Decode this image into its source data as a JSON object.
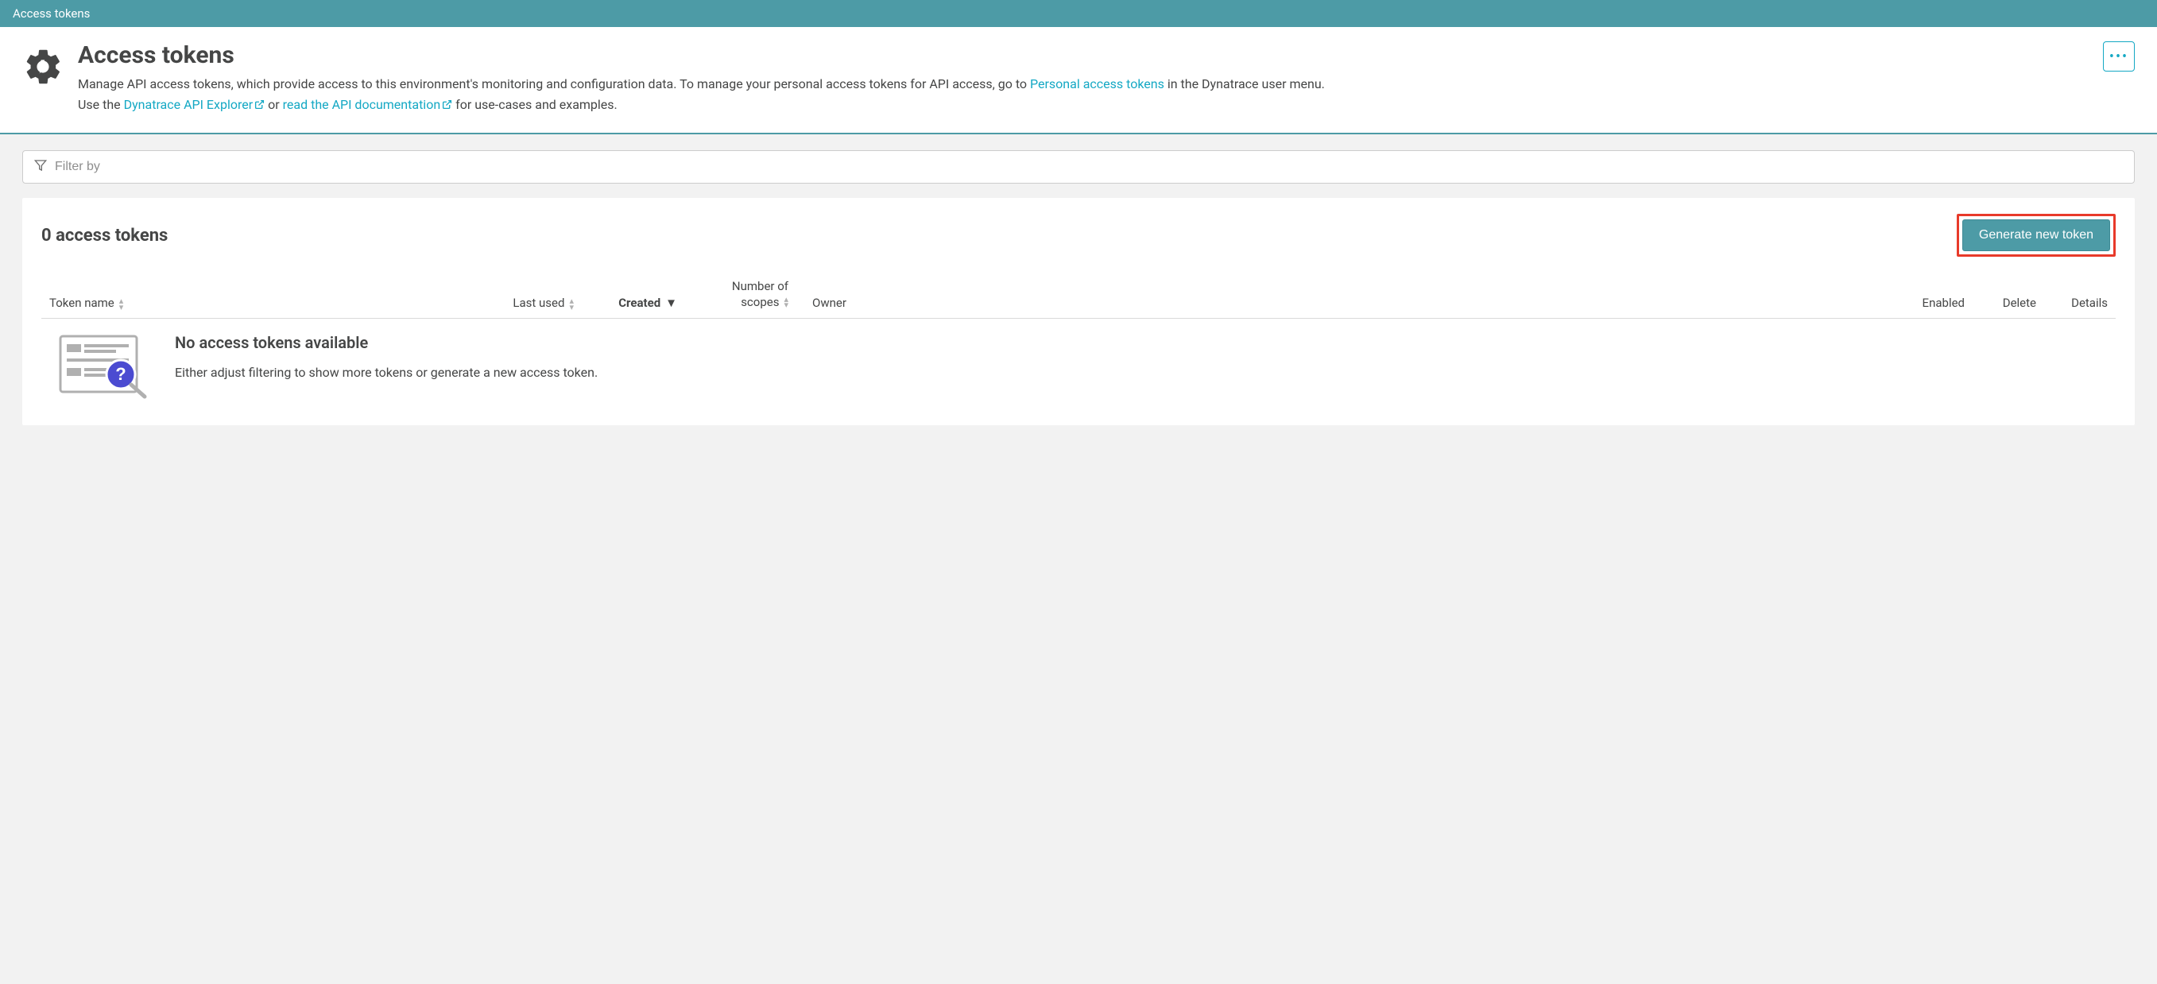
{
  "topBar": {
    "title": "Access tokens"
  },
  "header": {
    "title": "Access tokens",
    "desc1_a": "Manage API access tokens, which provide access to this environment's monitoring and configuration data. To manage your personal access tokens for API access, go to ",
    "personalLink": "Personal access tokens",
    "desc1_b": " in the Dynatrace user menu.",
    "desc2_a": "Use the ",
    "apiExplorerLink": "Dynatrace API Explorer",
    "desc2_b": " or ",
    "apiDocLink": "read the API documentation",
    "desc2_c": " for use-cases and examples."
  },
  "filter": {
    "placeholder": "Filter by"
  },
  "panel": {
    "countTitle": "0 access tokens",
    "generateLabel": "Generate new token"
  },
  "columns": {
    "name": "Token name",
    "lastUsed": "Last used",
    "created": "Created",
    "scopes1": "Number of",
    "scopes2": "scopes",
    "owner": "Owner",
    "enabled": "Enabled",
    "delete": "Delete",
    "details": "Details"
  },
  "empty": {
    "title": "No access tokens available",
    "message": "Either adjust filtering to show more tokens or generate a new access token."
  }
}
